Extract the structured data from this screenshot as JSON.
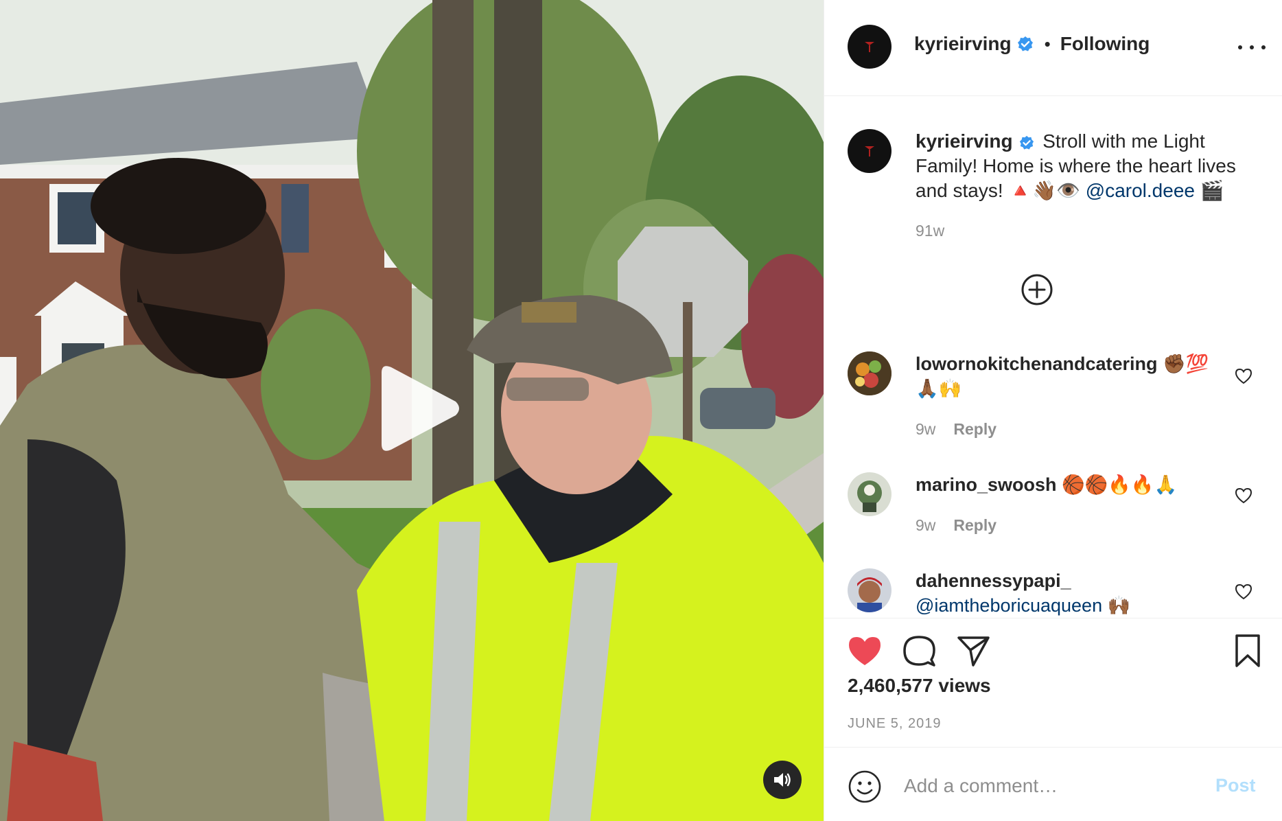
{
  "header": {
    "username": "kyrieirving",
    "dot": "•",
    "follow_status": "Following"
  },
  "caption": {
    "username": "kyrieirving",
    "text": "Stroll with me Light Family! Home is where the heart lives and stays! 🔺👋🏾👁️",
    "mention": "@carol.deee",
    "trailing_emoji": "🎬",
    "age": "91w"
  },
  "comments": [
    {
      "username": "lowornokitchenandcatering",
      "text": "✊🏾💯🙏🏾🙌",
      "age": "9w",
      "reply_label": "Reply"
    },
    {
      "username": "marino_swoosh",
      "text": "🏀🏀🔥🔥🙏",
      "age": "9w",
      "reply_label": "Reply"
    },
    {
      "username": "dahennessypapi_",
      "text": "@iamtheboricuaqueen 🙌🏾",
      "age": "",
      "reply_label": ""
    }
  ],
  "post": {
    "views": "2,460,577 views",
    "date": "JUNE 5, 2019",
    "liked": true
  },
  "composer": {
    "placeholder": "Add a comment…",
    "post_label": "Post"
  },
  "colors": {
    "like_red": "#ed4956",
    "verified_blue": "#3897f0",
    "link_blue": "#00376b",
    "post_disabled": "#b2dffc",
    "muted_gray": "#8e8e8e"
  },
  "icons": [
    "verified-badge-icon",
    "more-options-icon",
    "add-comment-circle-icon",
    "heart-icon",
    "comment-bubble-icon",
    "share-plane-icon",
    "bookmark-icon",
    "emoji-smiley-icon",
    "play-icon",
    "speaker-icon"
  ]
}
